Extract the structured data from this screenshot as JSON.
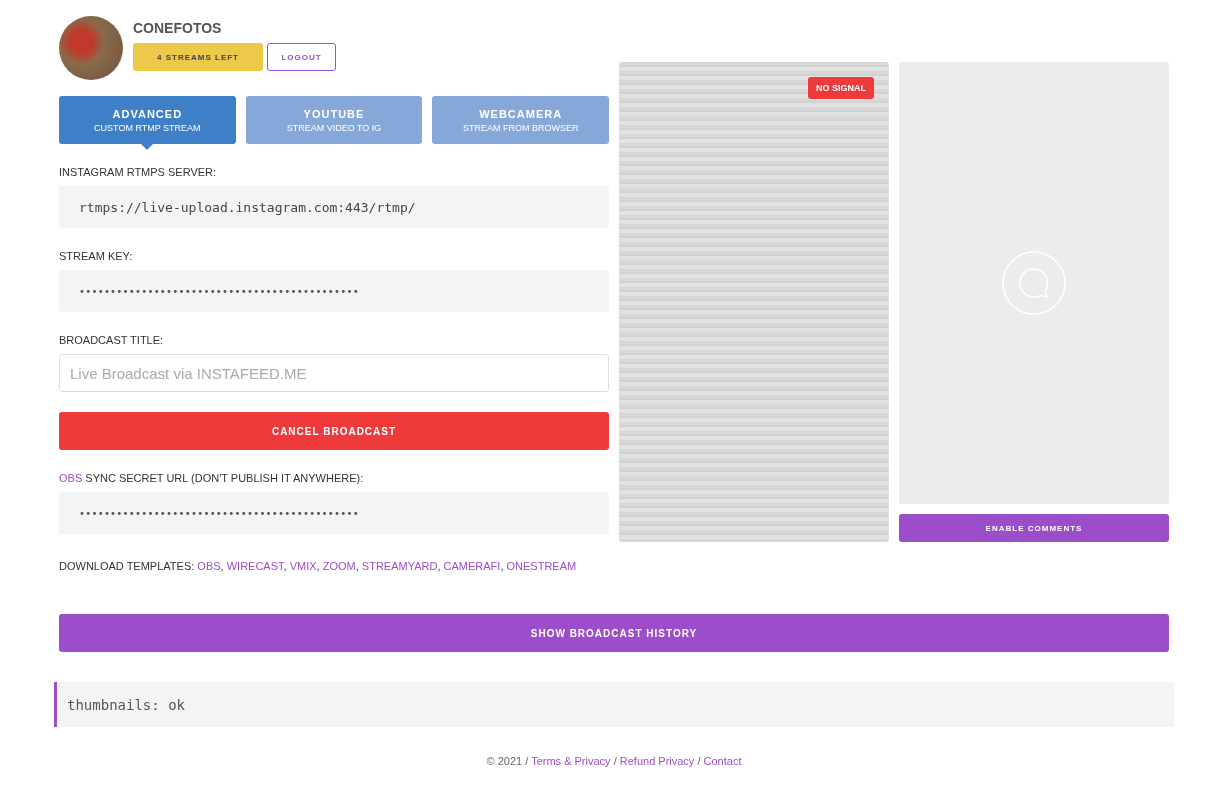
{
  "user": {
    "name": "CONEFOTOS",
    "streams_left": "4 STREAMS LEFT",
    "logout": "LOGOUT"
  },
  "tabs": [
    {
      "title": "ADVANCED",
      "subtitle": "CUSTOM RTMP STREAM",
      "selected": true
    },
    {
      "title": "YOUTUBE",
      "subtitle": "STREAM VIDEO TO IG",
      "selected": false
    },
    {
      "title": "WEBCAMERA",
      "subtitle": "STREAM FROM BROWSER",
      "selected": false
    }
  ],
  "server": {
    "label": "INSTAGRAM RTMPS SERVER:",
    "value": "rtmps://live-upload.instagram.com:443/rtmp/"
  },
  "stream_key": {
    "label": "STREAM KEY:",
    "value": "•••••••••••••••••••••••••••••••••••••••••••••"
  },
  "broadcast_title": {
    "label": "BROADCAST TITLE:",
    "placeholder": "Live Broadcast via INSTAFEED.ME"
  },
  "cancel_button": "CANCEL BROADCAST",
  "obs_sync": {
    "link": "OBS",
    "label": " SYNC SECRET URL (DON'T PUBLISH IT ANYWHERE):",
    "value": "•••••••••••••••••••••••••••••••••••••••••••••"
  },
  "templates": {
    "label": "DOWNLOAD TEMPLATES: ",
    "separator": ", ",
    "links": [
      "OBS",
      "WIRECAST",
      "VMIX",
      "ZOOM",
      "STREAMYARD",
      "CAMERAFI",
      "ONESTREAM"
    ]
  },
  "video": {
    "badge": "NO SIGNAL"
  },
  "comments": {
    "button": "ENABLE COMMENTS"
  },
  "history_button": "SHOW BROADCAST HISTORY",
  "log": "thumbnails: ok",
  "footer": {
    "copyright": "© 2021",
    "separator": " / ",
    "links": [
      "Terms & Privacy",
      "Refund Privacy",
      "Contact"
    ]
  }
}
